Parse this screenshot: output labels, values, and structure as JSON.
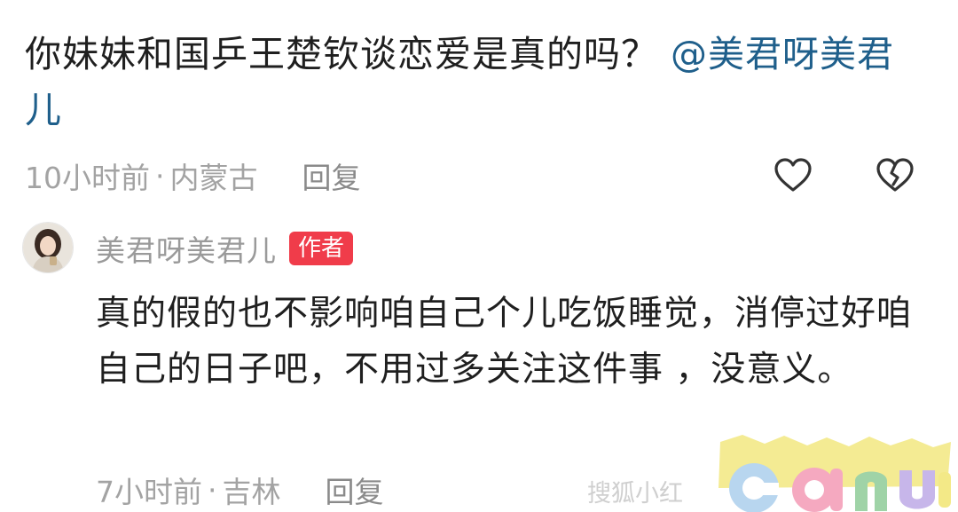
{
  "comment": {
    "text": "你妹妹和国乒王楚钦谈恋爱是真的吗？",
    "mention": "@美君呀美君儿",
    "time": "10小时前",
    "separator": "·",
    "location": "内蒙古",
    "reply_label": "回复"
  },
  "reply": {
    "author_name": "美君呀美君儿",
    "author_badge": "作者",
    "text": "真的假的也不影响咱自己个儿吃饭睡觉，消停过好咱自己的日子吧，不用过多关注这件事 ，没意义。",
    "time": "7小时前",
    "separator": "·",
    "location": "吉林",
    "reply_label": "回复"
  },
  "watermark": {
    "text": "搜狐小红",
    "logo_text": "canu",
    "icon": "canu-logo"
  },
  "icons": {
    "like": "heart-outline-icon",
    "dislike": "broken-heart-icon"
  },
  "colors": {
    "mention": "#1f5f8b",
    "badge": "#f03c4a",
    "meta": "#a3a3a3"
  }
}
